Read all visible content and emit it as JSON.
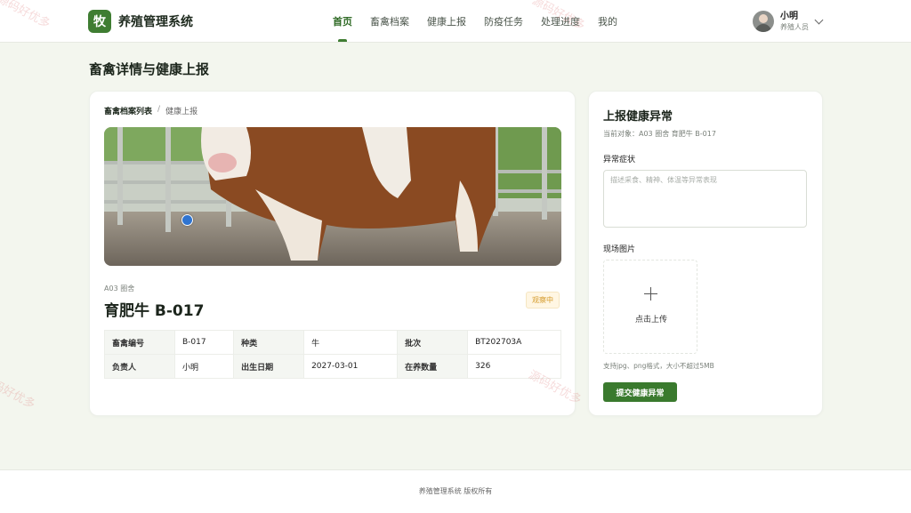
{
  "brand": {
    "logo_char": "牧",
    "name": "养殖管理系统"
  },
  "nav": [
    {
      "label": "首页",
      "active": true
    },
    {
      "label": "畜禽档案",
      "active": false
    },
    {
      "label": "健康上报",
      "active": false
    },
    {
      "label": "防疫任务",
      "active": false
    },
    {
      "label": "处理进度",
      "active": false
    },
    {
      "label": "我的",
      "active": false
    }
  ],
  "user": {
    "name": "小明",
    "role": "养殖人员"
  },
  "page": {
    "title": "畜禽详情与健康上报"
  },
  "breadcrumb": {
    "parent": "畜禽档案列表",
    "separator": "/",
    "current": "健康上报"
  },
  "animal": {
    "pen": "A03 圈舍",
    "name": "育肥牛 B-017",
    "status": "观察中",
    "info": [
      [
        {
          "k": "畜禽编号",
          "v": "B-017"
        },
        {
          "k": "种类",
          "v": "牛"
        },
        {
          "k": "批次",
          "v": "BT202703A"
        }
      ],
      [
        {
          "k": "负责人",
          "v": "小明"
        },
        {
          "k": "出生日期",
          "v": "2027-03-01"
        },
        {
          "k": "在养数量",
          "v": "326"
        }
      ]
    ]
  },
  "report": {
    "title": "上报健康异常",
    "target": "当前对象：A03 圈舍 育肥牛 B-017",
    "symptom_label": "异常症状",
    "symptom_placeholder": "描述采食、精神、体温等异常表现",
    "symptom_value": "",
    "photo_label": "现场图片",
    "upload_label": "点击上传",
    "upload_hint": "支持jpg、png格式，大小不超过5MB",
    "submit_label": "提交健康异常"
  },
  "footer": {
    "text": "养殖管理系统 版权所有"
  },
  "watermark": {
    "text": "源码好优多"
  },
  "colors": {
    "primary": "#3f7d32",
    "background": "#f3f6ee",
    "badge_text": "#d49a2a"
  }
}
